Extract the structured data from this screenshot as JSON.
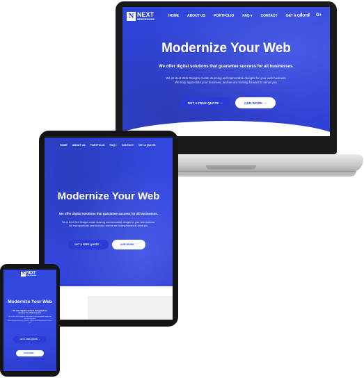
{
  "site": {
    "logo_letter": "N",
    "logo_name": "NEXT",
    "logo_tagline": "WEB DESIGNS",
    "nav": [
      "HOME",
      "ABOUT US",
      "PORTFOLIO",
      "FAQ",
      "CONTACT",
      "GET A QUOTE"
    ],
    "faq_arrow": "▾",
    "social": [
      "f",
      "t",
      "G+"
    ],
    "hero": {
      "title": "Modernize Your Web",
      "subtitle": "We offer digital solutions that guarantee success for all businesses.",
      "body_line1": "We at Next Web Designs create stunning and memorable designs for your web business.",
      "body_line2": "We truly appreciate your business, and we are looking forward to serve you.",
      "primary_button": "GET A FREE QUOTE",
      "secondary_button": "OUR WORK",
      "button_arrow": "→"
    }
  },
  "phone": {
    "hero_title": "Modernize Your Web",
    "subtitle_line1": "We offer digital solutions that guarantee",
    "subtitle_line2": "success for all businesses."
  },
  "colors": {
    "brand_blue": "#3548e0",
    "button_blue": "#2b3bd6",
    "white": "#ffffff"
  }
}
